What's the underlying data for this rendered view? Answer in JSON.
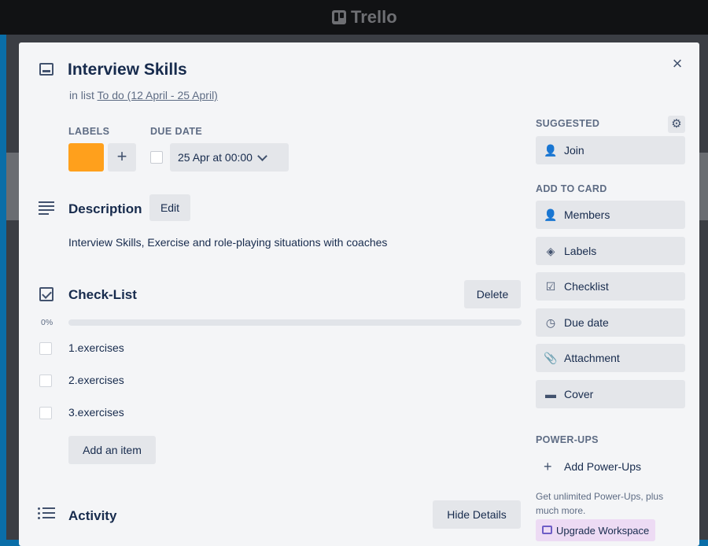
{
  "app": {
    "brand": "Trello"
  },
  "card": {
    "title": "Interview Skills",
    "in_list_prefix": "in list",
    "list_name": "To do (12 April - 25 April)",
    "labels_heading": "LABELS",
    "label_color": "#ffa01c",
    "add_label": "+",
    "due_heading": "DUE DATE",
    "due_value": "25 Apr at 00:00",
    "close": "×"
  },
  "description": {
    "heading": "Description",
    "edit_label": "Edit",
    "text": "Interview Skills, Exercise and role-playing situations with coaches"
  },
  "checklist": {
    "heading": "Check-List",
    "delete_label": "Delete",
    "progress_text": "0%",
    "progress": 0,
    "items": [
      {
        "text": "1.exercises",
        "checked": false
      },
      {
        "text": "2.exercises",
        "checked": false
      },
      {
        "text": "3.exercises",
        "checked": false
      }
    ],
    "add_item_label": "Add an item"
  },
  "activity": {
    "heading": "Activity",
    "hide_details_label": "Hide Details"
  },
  "sidebar": {
    "suggested_heading": "SUGGESTED",
    "join_label": "Join",
    "add_to_card_heading": "ADD TO CARD",
    "add_to_card": [
      {
        "label": "Members",
        "icon": "person-icon"
      },
      {
        "label": "Labels",
        "icon": "tag-icon"
      },
      {
        "label": "Checklist",
        "icon": "checkbox-icon"
      },
      {
        "label": "Due date",
        "icon": "clock-icon"
      },
      {
        "label": "Attachment",
        "icon": "paperclip-icon"
      },
      {
        "label": "Cover",
        "icon": "cover-icon"
      }
    ],
    "powerups_heading": "POWER-UPS",
    "add_powerups_label": "Add Power-Ups",
    "promo_text": "Get unlimited Power-Ups, plus much more.",
    "upgrade_label": "Upgrade Workspace"
  }
}
